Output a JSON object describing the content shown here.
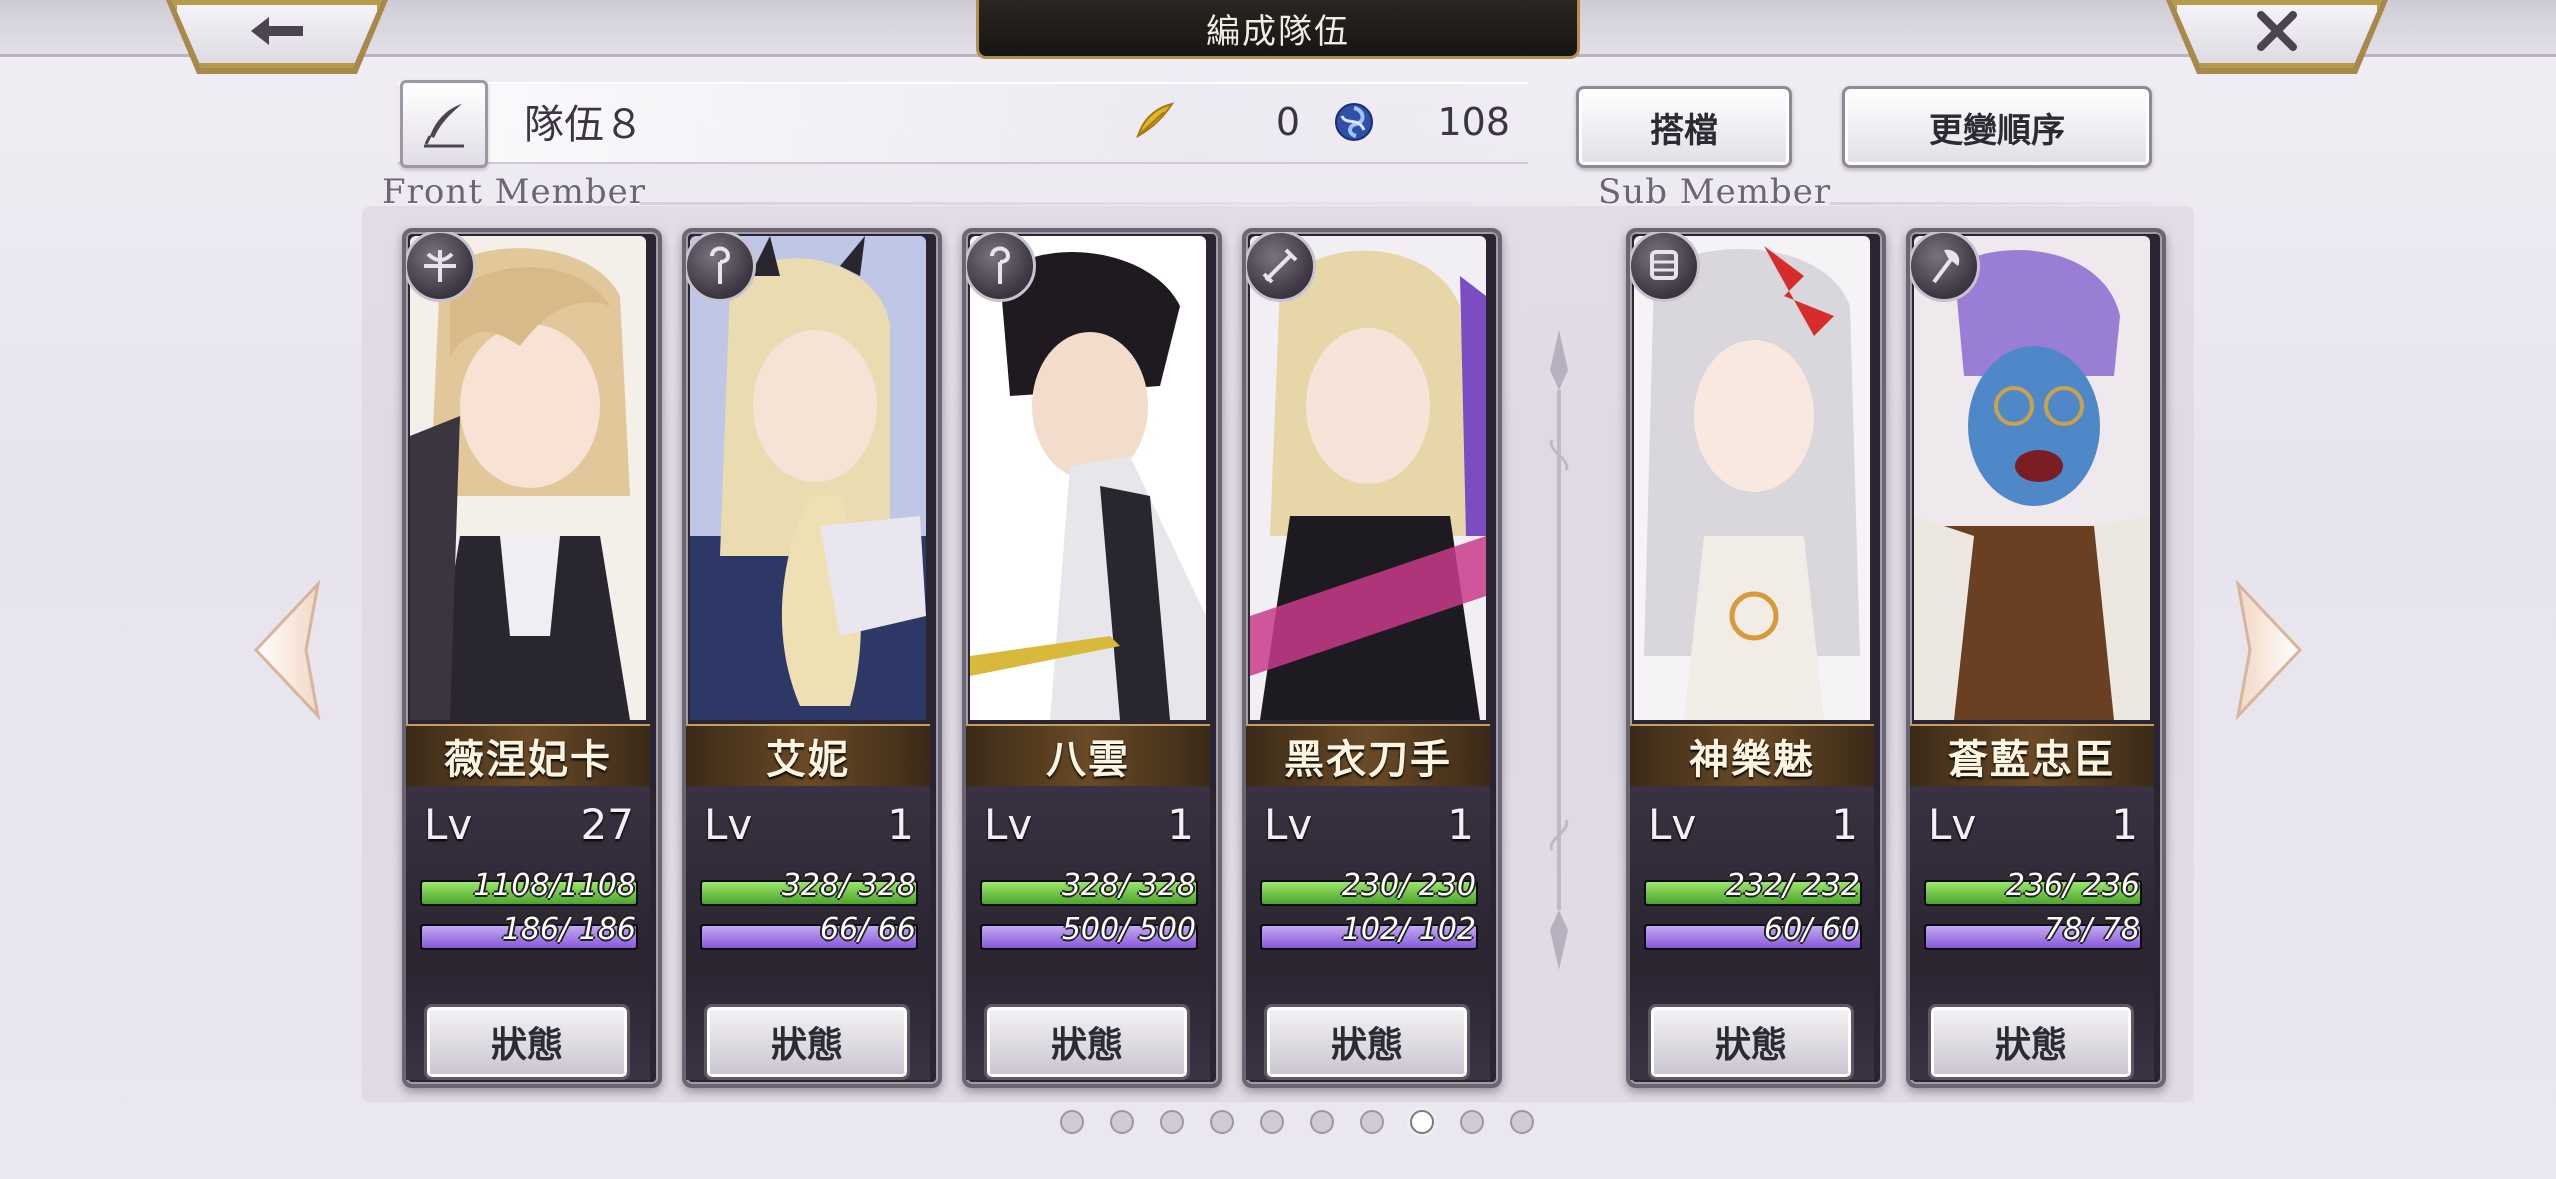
{
  "header": {
    "title": "編成隊伍"
  },
  "nav": {
    "back_icon": "back-arrow-icon",
    "close_icon": "close-icon"
  },
  "team": {
    "name": "隊伍８",
    "feather_count": "0",
    "gem_count": "108"
  },
  "buttons": {
    "partner": "搭檔",
    "change_order": "更變順序"
  },
  "sections": {
    "front": "Front Member",
    "sub": "Sub Member"
  },
  "status_label": "狀態",
  "lv_label": "Lv",
  "colors": {
    "hp": "#6cc23f",
    "sp": "#a57ae6",
    "gold": "#b89a4b"
  },
  "members": [
    {
      "name": "薇涅妃卡",
      "level": "27",
      "hp": "1108/1108",
      "sp": "186/ 186",
      "class_icon": "crossbow-icon",
      "group": "front"
    },
    {
      "name": "艾妮",
      "level": "1",
      "hp": "328/ 328",
      "sp": "66/ 66",
      "class_icon": "staff-icon",
      "group": "front"
    },
    {
      "name": "八雲",
      "level": "1",
      "hp": "328/ 328",
      "sp": "500/ 500",
      "class_icon": "staff-icon",
      "group": "front"
    },
    {
      "name": "黑衣刀手",
      "level": "1",
      "hp": "230/ 230",
      "sp": "102/ 102",
      "class_icon": "sword-icon",
      "group": "front"
    },
    {
      "name": "神樂魅",
      "level": "1",
      "hp": "232/ 232",
      "sp": "60/ 60",
      "class_icon": "gauntlet-icon",
      "group": "sub"
    },
    {
      "name": "蒼藍忠臣",
      "level": "1",
      "hp": "236/ 236",
      "sp": "78/ 78",
      "class_icon": "axe-icon",
      "group": "sub"
    }
  ],
  "pager": {
    "total": 10,
    "active": 8
  }
}
